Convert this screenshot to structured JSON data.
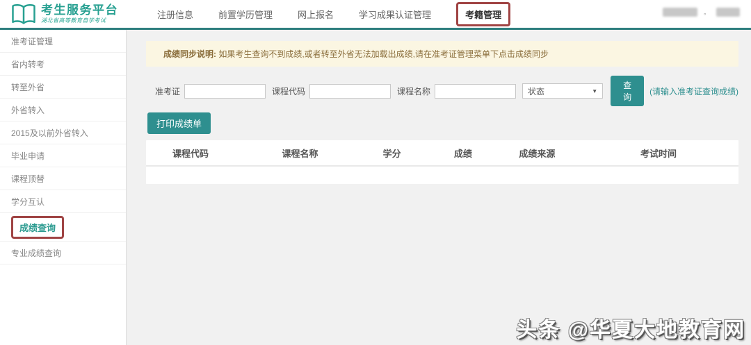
{
  "header": {
    "brand": {
      "title": "考生服务平台",
      "subtitle": "湖北省高等教育自学考试"
    },
    "nav": [
      {
        "label": "注册信息",
        "active": false
      },
      {
        "label": "前置学历管理",
        "active": false
      },
      {
        "label": "网上报名",
        "active": false
      },
      {
        "label": "学习成果认证管理",
        "active": false
      },
      {
        "label": "考籍管理",
        "active": true
      }
    ]
  },
  "sidebar": {
    "items": [
      {
        "label": "准考证管理",
        "active": false
      },
      {
        "label": "省内转考",
        "active": false
      },
      {
        "label": "转至外省",
        "active": false
      },
      {
        "label": "外省转入",
        "active": false
      },
      {
        "label": "2015及以前外省转入",
        "active": false
      },
      {
        "label": "毕业申请",
        "active": false
      },
      {
        "label": "课程顶替",
        "active": false
      },
      {
        "label": "学分互认",
        "active": false
      },
      {
        "label": "成绩查询",
        "active": true
      },
      {
        "label": "专业成绩查询",
        "active": false
      }
    ]
  },
  "main": {
    "notice_label": "成绩同步说明: ",
    "notice_text": "如果考生查询不到成绩,或者转至外省无法加载出成绩,请在准考证管理菜单下点击成绩同步",
    "filters": {
      "exam_no_label": "准考证",
      "course_code_label": "课程代码",
      "course_name_label": "课程名称",
      "status_selected": "状态",
      "caret_icon": "▼",
      "search_button": "查询",
      "hint": "(请输入准考证查询成绩)",
      "print_button": "打印成绩单"
    },
    "table": {
      "headers": [
        "课程代码",
        "课程名称",
        "学分",
        "成绩",
        "成绩来源",
        "考试时间"
      ],
      "rows": []
    }
  },
  "watermark": "头条 @华夏大地教育网",
  "colors": {
    "accent_teal": "#2e8f8f",
    "brand_teal": "#27a091",
    "header_border_teal": "#2d7e7e",
    "highlight_red": "#a04444",
    "notice_bg": "#fbf6e2",
    "notice_text": "#8a6d3b",
    "main_bg": "#f1f1f1"
  }
}
